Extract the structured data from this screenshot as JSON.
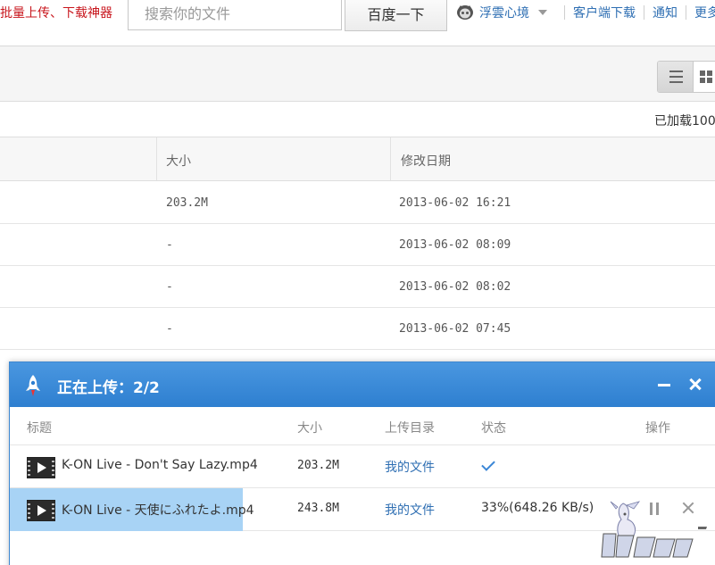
{
  "header": {
    "promo_text": "批量上传、下载神器",
    "search_placeholder": "搜索你的文件",
    "search_button": "百度一下",
    "user_name": "浮雲心境",
    "links": [
      "客户端下载",
      "通知",
      "更多"
    ]
  },
  "toolbar": {
    "loaded_text": "已加载100"
  },
  "file_table": {
    "columns": [
      "大小",
      "修改日期"
    ],
    "rows": [
      {
        "size": "203.2M",
        "date": "2013-06-02 16:21"
      },
      {
        "size": "-",
        "date": "2013-06-02 08:09"
      },
      {
        "size": "-",
        "date": "2013-06-02 08:02"
      },
      {
        "size": "-",
        "date": "2013-06-02 07:45"
      }
    ]
  },
  "upload_panel": {
    "title": "正在上传：2/2",
    "columns": {
      "name": "标题",
      "size": "大小",
      "dir": "上传目录",
      "status": "状态",
      "action": "操作"
    },
    "items": [
      {
        "name": "K-ON Live - Don't Say Lazy.mp4",
        "size": "203.2M",
        "dir": "我的文件",
        "status": "",
        "done": true
      },
      {
        "name": "K-ON Live - 天使にふれたよ.mp4",
        "size": "243.8M",
        "dir": "我的文件",
        "status": "33%(648.26 KB/s)",
        "progress": 0.33
      }
    ]
  },
  "colors": {
    "panel_header": "#2e7fd0",
    "progress_fill": "#a8d3f5",
    "link_blue": "#2f6fb3",
    "promo_red": "#c8161d"
  },
  "icons": [
    "user-avatar-icon",
    "list-view-icon",
    "grid-view-icon",
    "rocket-icon",
    "video-file-icon",
    "check-icon",
    "pause-icon",
    "close-icon",
    "minimize-icon"
  ]
}
